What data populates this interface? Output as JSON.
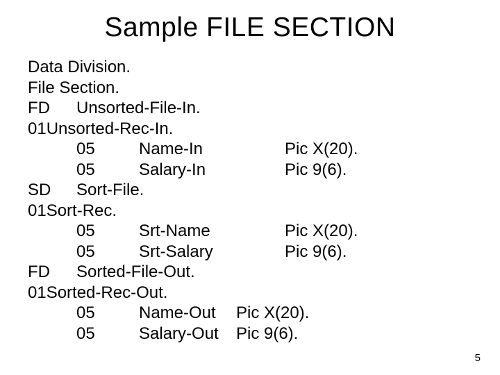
{
  "title": "Sample FILE SECTION",
  "lines": [
    "Data Division.",
    "File Section.",
    "FD\tUnsorted-File-In.",
    "01Unsorted-Rec-In.",
    "\t05\tName-In\t\tPic X(20).",
    "\t05\tSalary-In\t\tPic 9(6).",
    "SD\tSort-File.",
    "01Sort-Rec.",
    "\t05\tSrt-Name\t\tPic X(20).",
    "\t05\tSrt-Salary\t\tPic 9(6).",
    "FD\tSorted-File-Out.",
    "01Sorted-Rec-Out.",
    "\t05\tName-Out\tPic X(20).",
    "\t05\tSalary-Out\tPic 9(6)."
  ],
  "page_number": "5"
}
